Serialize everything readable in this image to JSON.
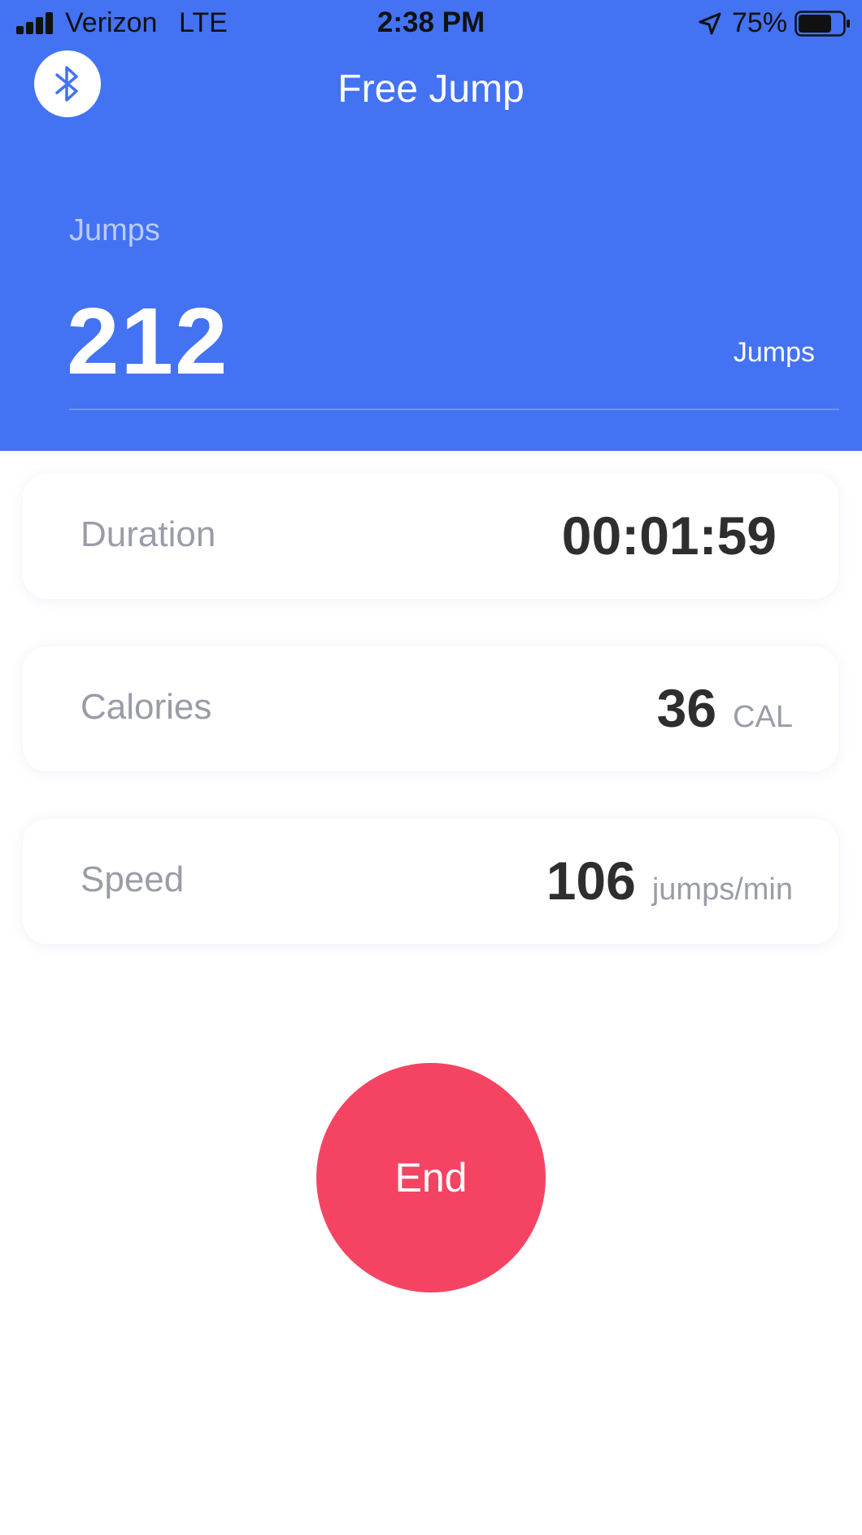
{
  "status_bar": {
    "carrier": "Verizon",
    "network": "LTE",
    "time": "2:38 PM",
    "battery_percent": "75%",
    "battery_level": 0.75,
    "icons": [
      "signal-bars-icon",
      "location-arrow-icon",
      "battery-icon"
    ]
  },
  "header": {
    "title": "Free Jump",
    "bluetooth_icon": "bluetooth-icon",
    "jumps_label": "Jumps",
    "jumps_value": "212",
    "jumps_unit": "Jumps"
  },
  "stats": {
    "duration": {
      "label": "Duration",
      "value": "00:01:59"
    },
    "calories": {
      "label": "Calories",
      "value": "36",
      "unit": "CAL"
    },
    "speed": {
      "label": "Speed",
      "value": "106",
      "unit": "jumps/min"
    }
  },
  "end_button": {
    "label": "End"
  },
  "colors": {
    "header_bg": "#4372F2",
    "end_button": "#F54463",
    "value_text": "#2E2E2E",
    "muted_text": "#9A9DA8"
  }
}
